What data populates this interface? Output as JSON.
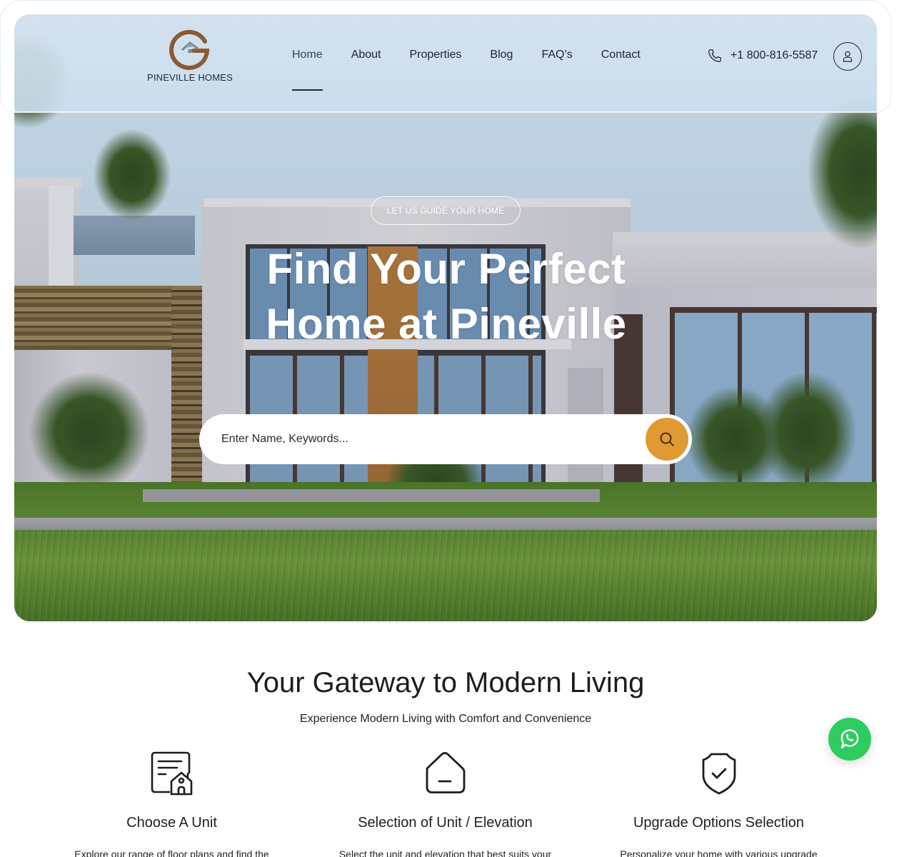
{
  "brand": {
    "name": "PINEVILLE HOMES",
    "logo_icon": "g-house-logo",
    "colors": {
      "logo_ring": "#8a5a34",
      "accent": "#e09a33",
      "whatsapp": "#2ecc5f"
    }
  },
  "nav": {
    "items": [
      {
        "label": "Home",
        "active": true
      },
      {
        "label": "About",
        "active": false
      },
      {
        "label": "Properties",
        "active": false
      },
      {
        "label": "Blog",
        "active": false
      },
      {
        "label": "FAQ’s",
        "active": false
      },
      {
        "label": "Contact",
        "active": false
      }
    ]
  },
  "contact": {
    "phone_icon": "phone-icon",
    "phone": "+1 800-816-5587",
    "user_icon": "user-icon"
  },
  "hero": {
    "badge": "LET US GUIDE YOUR HOME",
    "title_line1": "Find Your Perfect",
    "title_line2": "Home at Pineville",
    "search": {
      "placeholder": "Enter Name, Keywords...",
      "value": "",
      "button_icon": "search-icon"
    }
  },
  "gateway": {
    "title": "Your Gateway to Modern Living",
    "subtitle": "Experience Modern Living with Comfort and Convenience",
    "features": [
      {
        "icon": "document-house-icon",
        "title": "Choose A Unit",
        "description": "Explore our range of floor plans and find the"
      },
      {
        "icon": "home-outline-icon",
        "title": "Selection of Unit / Elevation",
        "description": "Select the unit and elevation that best suits your"
      },
      {
        "icon": "shield-check-icon",
        "title": "Upgrade Options Selection",
        "description": "Personalize your home with various upgrade"
      }
    ]
  },
  "floating": {
    "whatsapp_icon": "whatsapp-icon"
  }
}
